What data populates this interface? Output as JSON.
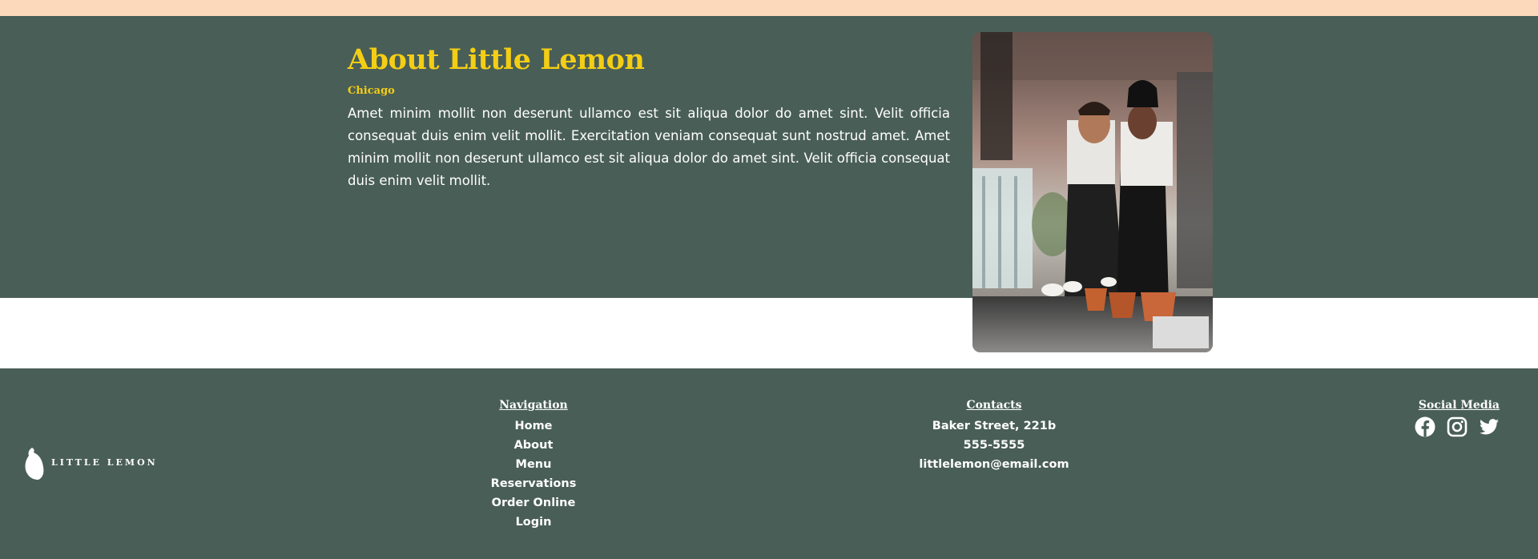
{
  "about": {
    "title": "About Little Lemon",
    "city": "Chicago",
    "description": "Amet minim mollit non deserunt ullamco est sit aliqua dolor do amet sint. Velit officia consequat duis enim velit mollit. Exercitation veniam consequat sunt nostrud amet. Amet minim mollit non deserunt ullamco est sit aliqua dolor do amet sint. Velit officia consequat duis enim velit mollit."
  },
  "footer": {
    "logo_text": "LITTLE LEMON",
    "navigation": {
      "heading": "Navigation",
      "links": [
        "Home",
        "About",
        "Menu",
        "Reservations",
        "Order Online",
        "Login"
      ]
    },
    "contacts": {
      "heading": "Contacts",
      "address": "Baker Street, 221b",
      "phone": "555-5555",
      "email": "littlelemon@email.com"
    },
    "social": {
      "heading": "Social Media",
      "icons": [
        "facebook-icon",
        "instagram-icon",
        "twitter-icon"
      ]
    }
  },
  "colors": {
    "primary_green": "#495e57",
    "primary_yellow": "#f4ce14",
    "peach": "#fcd9bb",
    "white": "#ffffff"
  }
}
